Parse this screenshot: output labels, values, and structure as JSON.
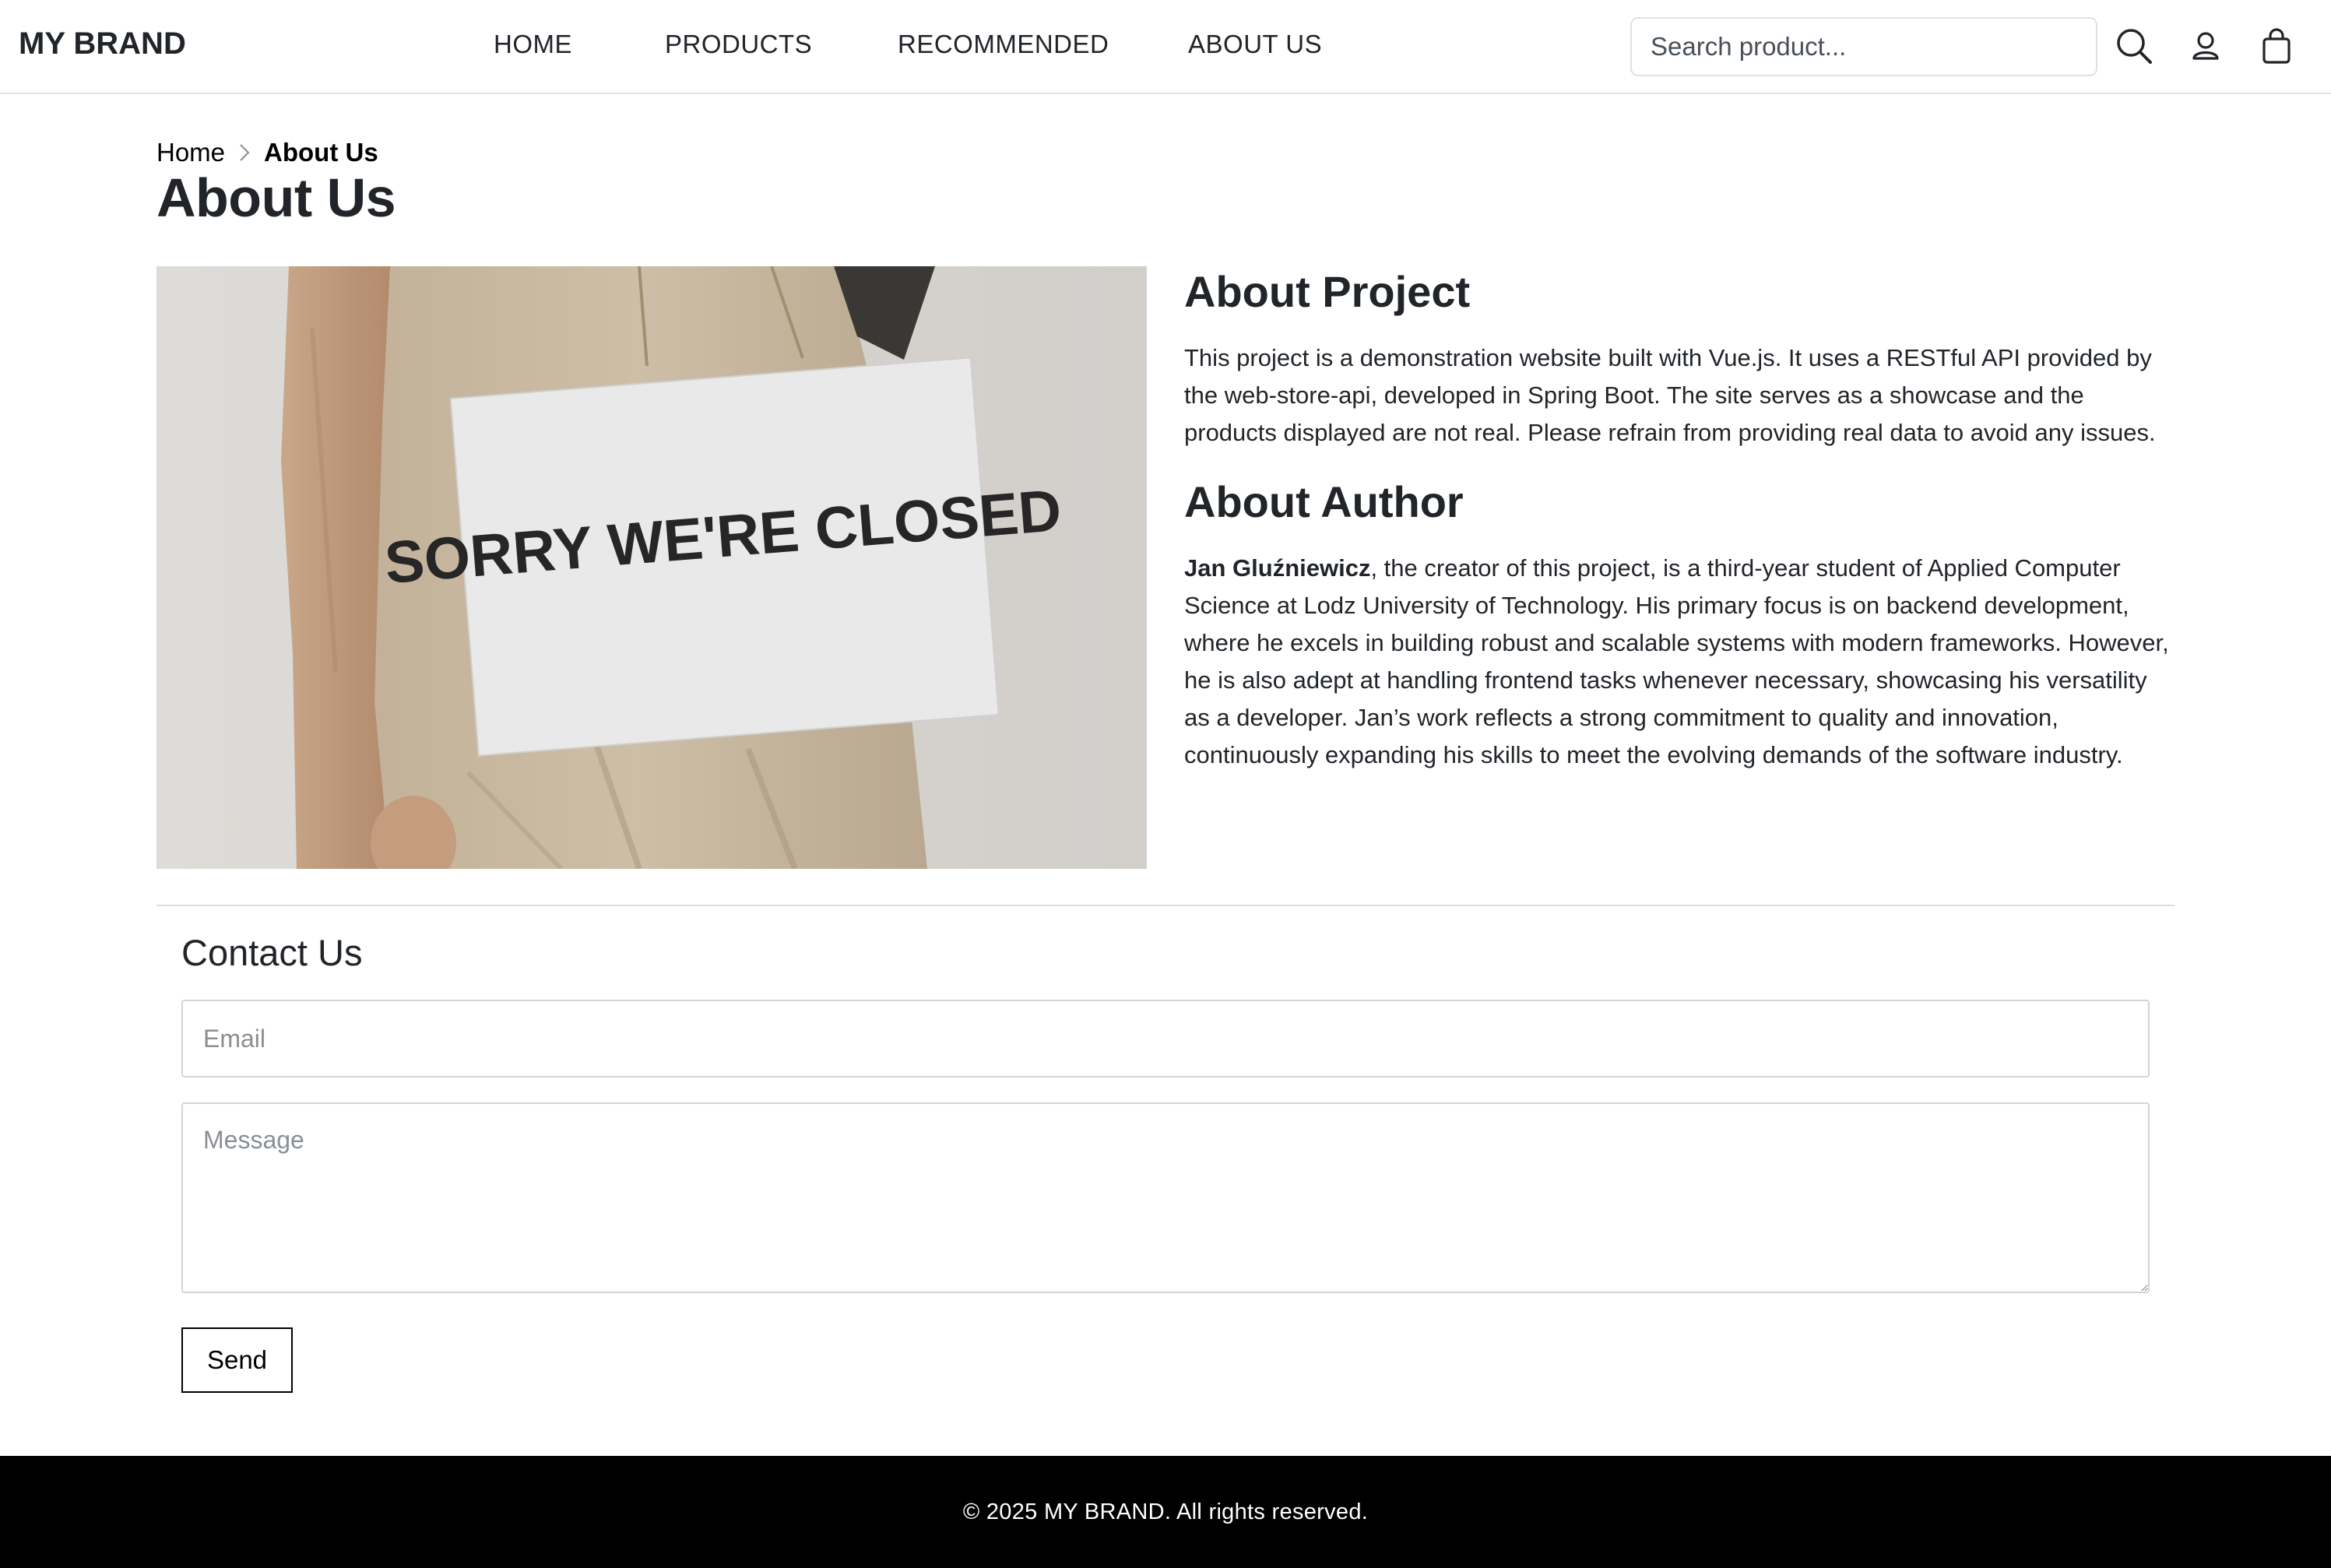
{
  "navbar": {
    "brand": "MY BRAND",
    "links": [
      {
        "label": "HOME"
      },
      {
        "label": "PRODUCTS"
      },
      {
        "label": "RECOMMENDED"
      },
      {
        "label": "ABOUT US"
      }
    ],
    "search_placeholder": "Search product...",
    "icons": [
      "search-icon",
      "user-icon",
      "shopping-bag-icon"
    ]
  },
  "breadcrumb": {
    "home": "Home",
    "separator_icon": "chevron-right-icon",
    "current": "About Us"
  },
  "page_title": "About Us",
  "hero_image": {
    "sign_text": "SORRY WE'RE CLOSED",
    "colors": {
      "wall": "#d9d7d3",
      "apron": "#c9b9a0",
      "sign": "#e8e8e8",
      "lettering": "#262626"
    }
  },
  "about_project": {
    "heading": "About Project",
    "text": "This project is a demonstration website built with Vue.js. It uses a RESTful API provided by the web-store-api, developed in Spring Boot. The site serves as a showcase and the products displayed are not real. Please refrain from providing real data to avoid any issues."
  },
  "about_author": {
    "heading": "About Author",
    "author_name": "Jan Gluźniewicz",
    "text": ", the creator of this project, is a third-year student of Applied Computer Science at Lodz University of Technology. His primary focus is on backend development, where he excels in building robust and scalable systems with modern frameworks. However, he is also adept at handling frontend tasks whenever necessary, showcasing his versatility as a developer. Jan’s work reflects a strong commitment to quality and innovation, continuously expanding his skills to meet the evolving demands of the software industry."
  },
  "contact": {
    "heading": "Contact Us",
    "email_placeholder": "Email",
    "email_value": "",
    "message_placeholder": "Message",
    "message_value": "",
    "send_label": "Send"
  },
  "footer": {
    "text": "© 2025 MY BRAND. All rights reserved."
  }
}
